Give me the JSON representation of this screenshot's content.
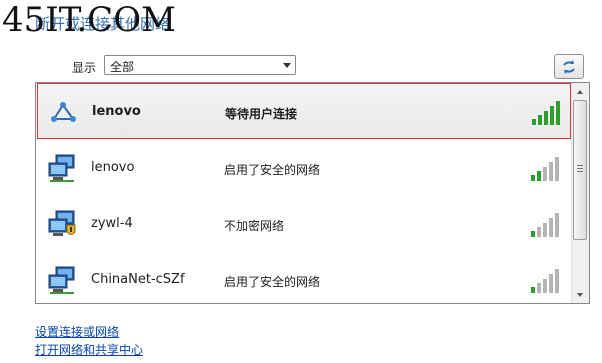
{
  "watermark": "45IT.COM",
  "header": {
    "title": "断开或连接其他网络"
  },
  "filter": {
    "label": "显示",
    "selected": "全部"
  },
  "networks": [
    {
      "name": "lenovo",
      "status": "等待用户连接",
      "selected": true,
      "icon": "adhoc-network-icon",
      "signal_bars": 5
    },
    {
      "name": "lenovo",
      "status": "启用了安全的网络",
      "selected": false,
      "icon": "secured-network-icon",
      "signal_bars": 2
    },
    {
      "name": "zywl-4",
      "status": "不加密网络",
      "selected": false,
      "icon": "unsecured-network-icon",
      "signal_bars": 1
    },
    {
      "name": "ChinaNet-cSZf",
      "status": "启用了安全的网络",
      "selected": false,
      "icon": "secured-network-icon",
      "signal_bars": 1
    }
  ],
  "links": {
    "setup": "设置连接或网络",
    "center": "打开网络和共享中心"
  },
  "colors": {
    "signal_active": "#2e9e2e",
    "signal_inactive": "#b5b5b5",
    "link": "#0645ad",
    "title": "#1e5fa8",
    "selection_border": "#d43a3a"
  }
}
